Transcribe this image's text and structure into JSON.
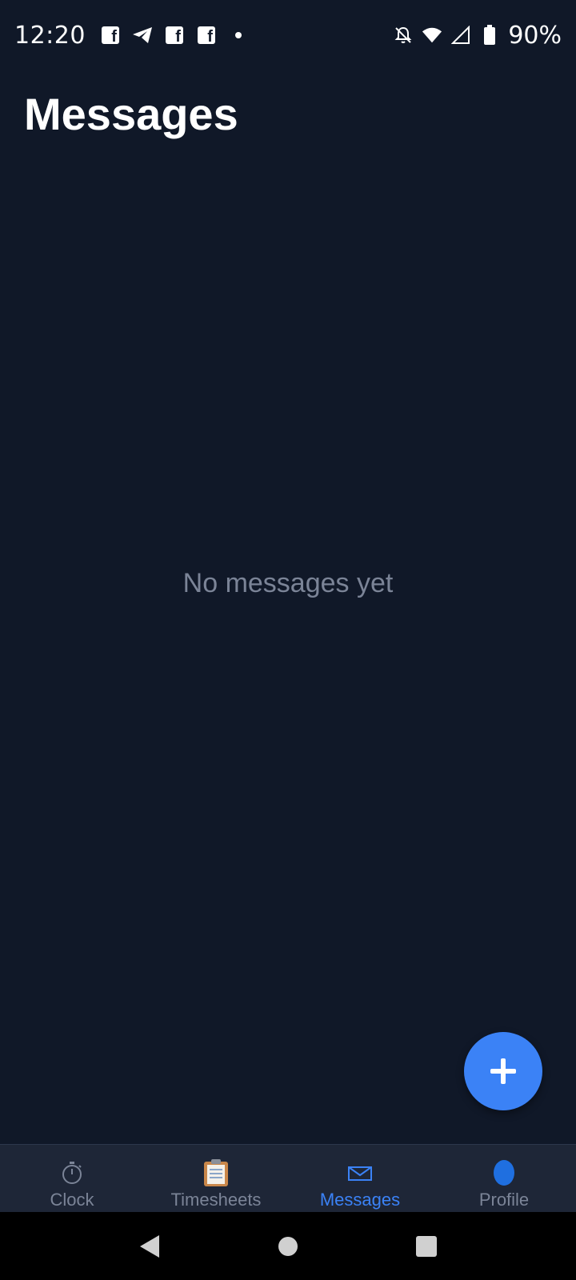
{
  "status_bar": {
    "time": "12:20",
    "battery": "90%",
    "left_icons": [
      "facebook-icon",
      "telegram-icon",
      "facebook-icon",
      "facebook-icon",
      "dot-icon"
    ],
    "right_icons": [
      "bell-off-icon",
      "wifi-icon",
      "signal-icon",
      "battery-icon"
    ]
  },
  "header": {
    "title": "Messages"
  },
  "main": {
    "empty_text": "No messages yet"
  },
  "fab": {
    "icon": "plus-icon",
    "color": "#3b82f6"
  },
  "bottom_nav": {
    "items": [
      {
        "label": "Clock",
        "icon": "stopwatch-icon",
        "active": false
      },
      {
        "label": "Timesheets",
        "icon": "clipboard-icon",
        "active": false
      },
      {
        "label": "Messages",
        "icon": "envelope-icon",
        "active": true
      },
      {
        "label": "Profile",
        "icon": "profile-icon",
        "active": false
      }
    ],
    "active_color": "#3b82f6",
    "inactive_color": "#7b8497"
  },
  "system_nav": {
    "buttons": [
      "back-icon",
      "home-icon",
      "recents-icon"
    ]
  },
  "colors": {
    "background": "#101828",
    "nav_background": "#1e2637",
    "muted_text": "#7b8497"
  }
}
